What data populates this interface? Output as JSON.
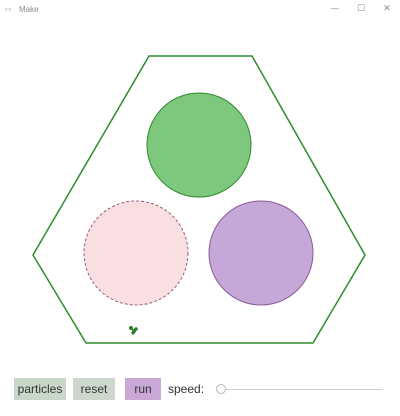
{
  "window": {
    "title": "Make",
    "icon": "app-icon",
    "controls": {
      "minimize": "—",
      "maximize": "☐",
      "close": "✕"
    }
  },
  "scene": {
    "container_shape": "hexagon",
    "container_color": "#2e8b2e",
    "circles": [
      {
        "name": "green-circle",
        "fill": "#7dc87d",
        "stroke": "#2e8b2e",
        "style": "solid"
      },
      {
        "name": "pink-circle",
        "fill": "#f8e0e2",
        "stroke": "#a05a7a",
        "style": "dashed"
      },
      {
        "name": "purple-circle",
        "fill": "#c5a8d8",
        "stroke": "#8a5a9a",
        "style": "solid"
      }
    ],
    "particle_color": "#2e7d2e"
  },
  "controls": {
    "particles_label": "particles",
    "reset_label": "reset",
    "run_label": "run",
    "speed_label": "speed:",
    "speed_value": 0
  }
}
